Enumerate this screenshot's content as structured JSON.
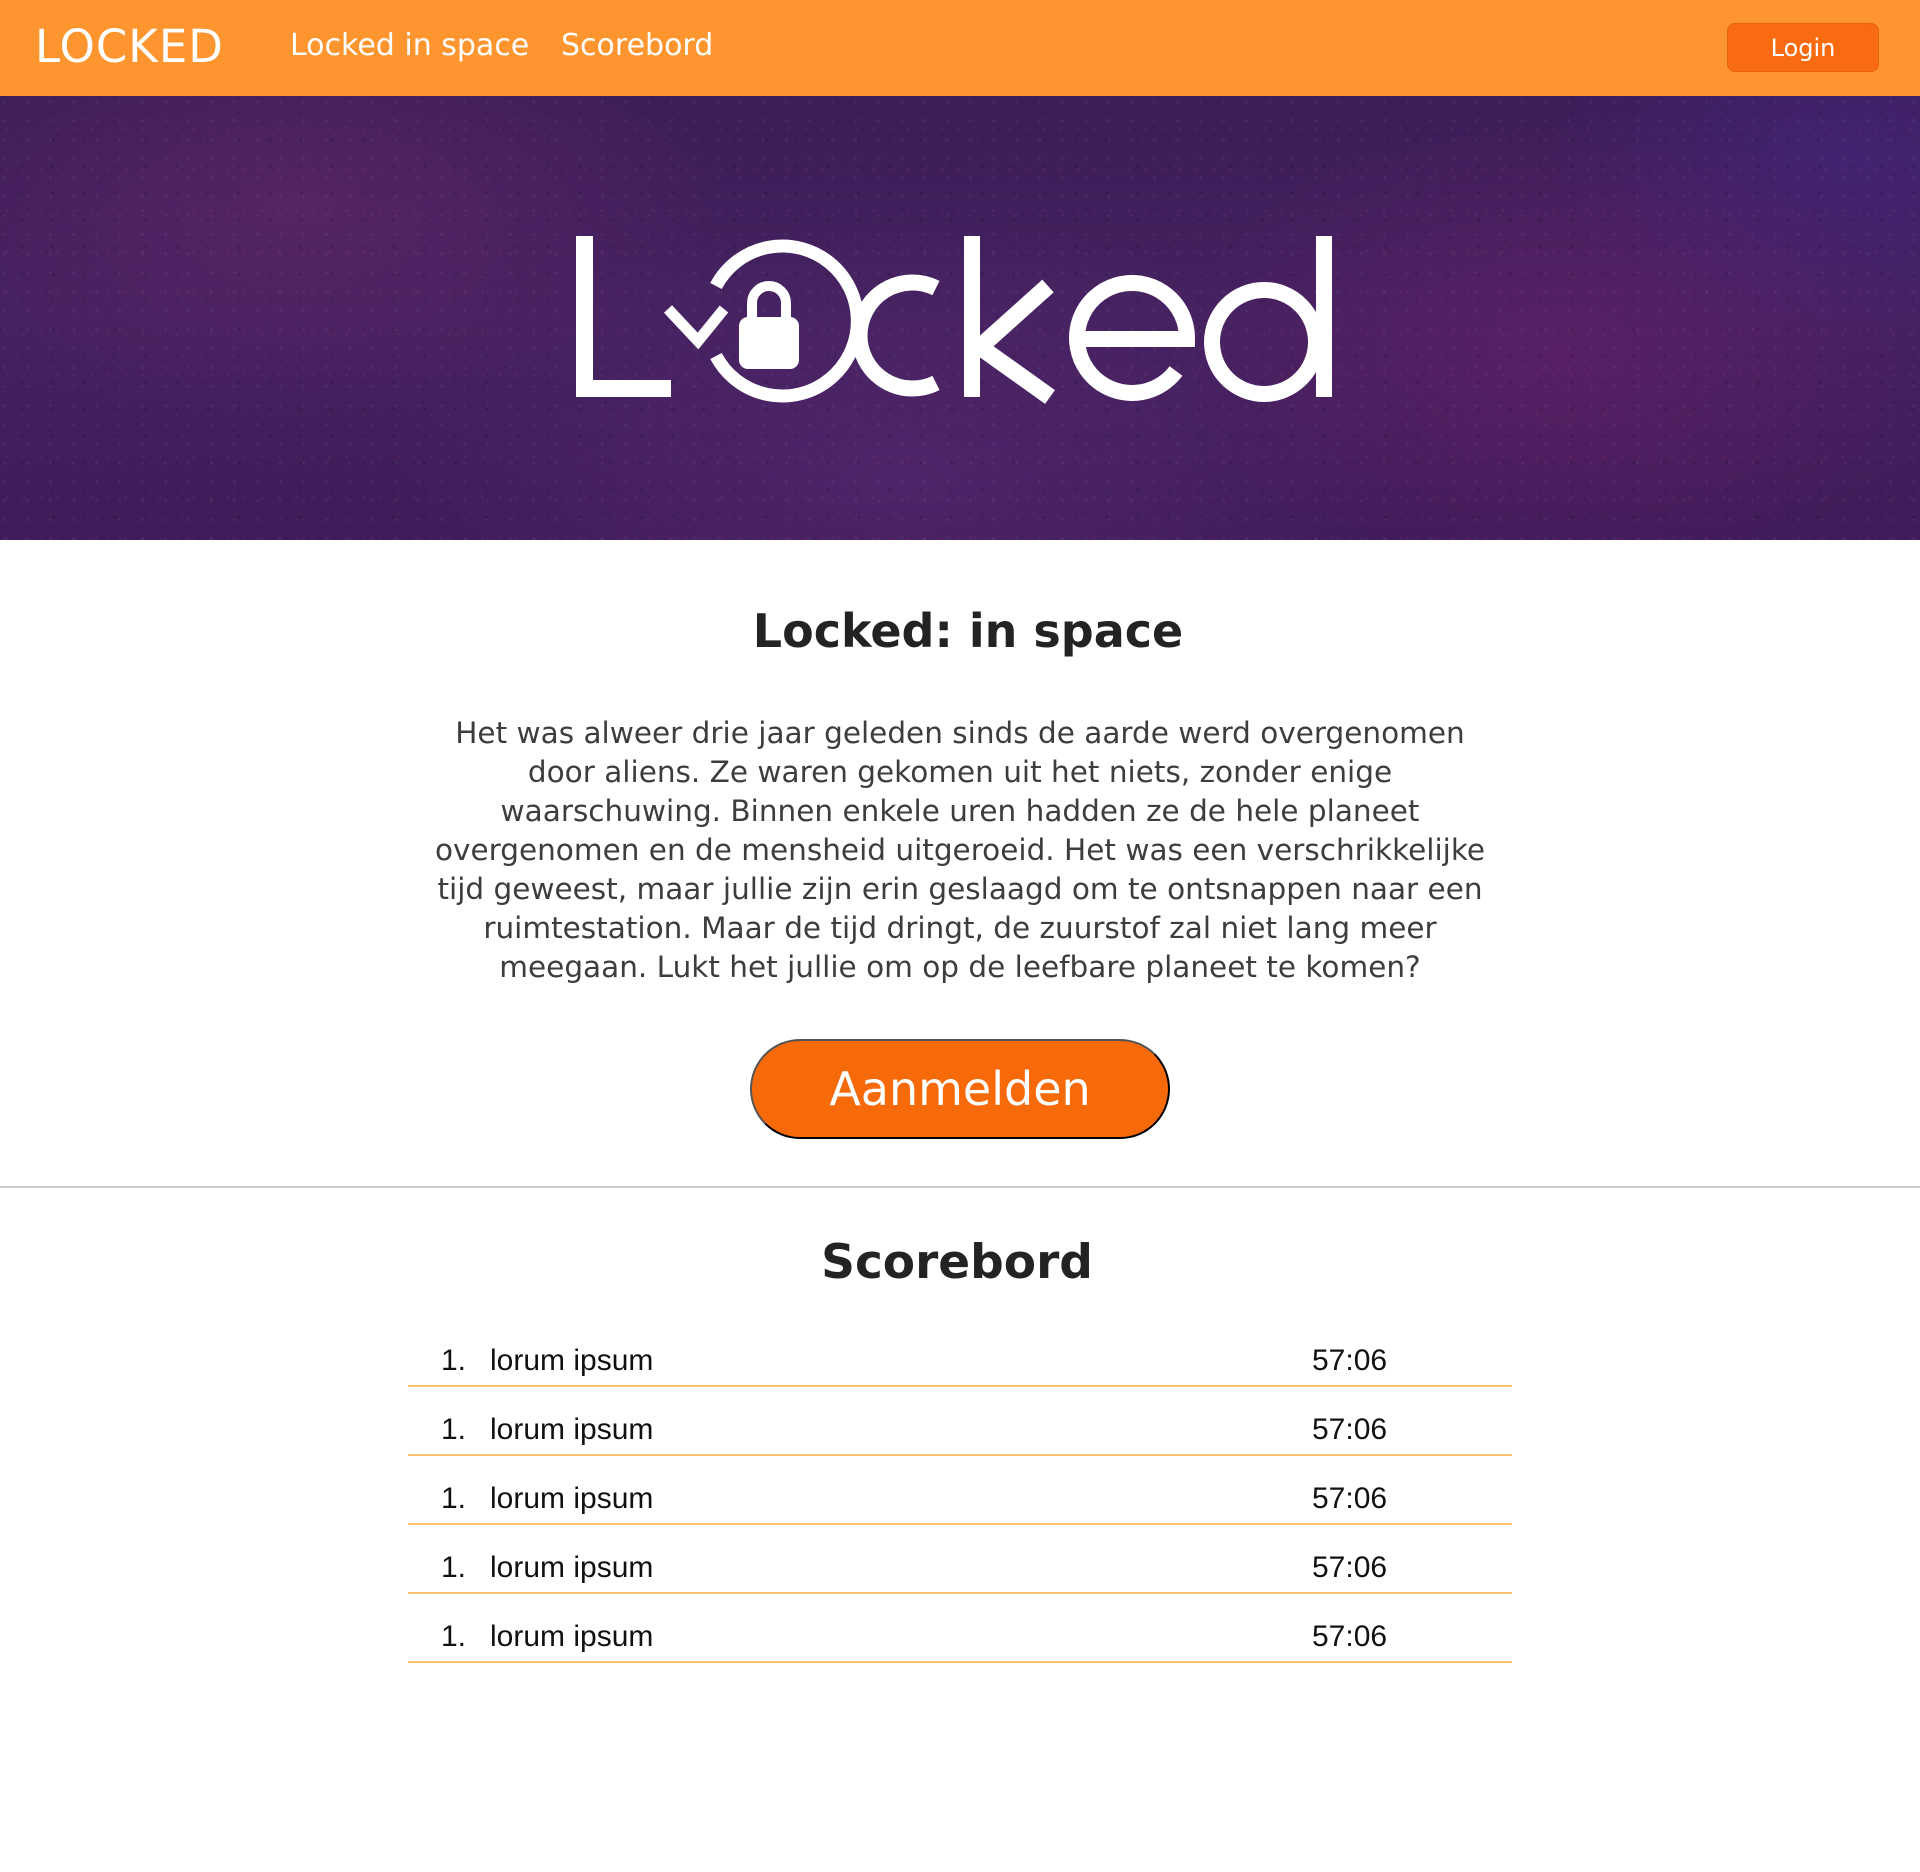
{
  "navbar": {
    "brand": "LOCKED",
    "links": [
      "Locked in space",
      "Scorebord"
    ],
    "login_label": "Login",
    "color": "#fe952f"
  },
  "hero": {
    "logo_text": "Locked",
    "logo_icon": "lock-refresh-icon"
  },
  "intro": {
    "title": "Locked: in space",
    "body": "Het was alweer drie jaar geleden sinds de aarde werd overgenomen door aliens. Ze waren gekomen uit het niets, zonder enige waarschuwing. Binnen enkele uren hadden ze de hele planeet overgenomen en de mensheid uitgeroeid. Het was een verschrikkelijke tijd geweest, maar jullie zijn erin geslaagd om te ontsnappen naar een ruimtestation. Maar de tijd dringt, de zuurstof zal niet lang meer meegaan. Lukt het jullie om op de leefbare planeet te komen?",
    "cta_label": "Aanmelden",
    "cta_color": "#f66a0a"
  },
  "scoreboard": {
    "title": "Scorebord",
    "rows": [
      {
        "rank": "1.",
        "name": "lorum ipsum",
        "time": "57:06"
      },
      {
        "rank": "1.",
        "name": "lorum ipsum",
        "time": "57:06"
      },
      {
        "rank": "1.",
        "name": "lorum ipsum",
        "time": "57:06"
      },
      {
        "rank": "1.",
        "name": "lorum ipsum",
        "time": "57:06"
      },
      {
        "rank": "1.",
        "name": "lorum ipsum",
        "time": "57:06"
      }
    ]
  }
}
